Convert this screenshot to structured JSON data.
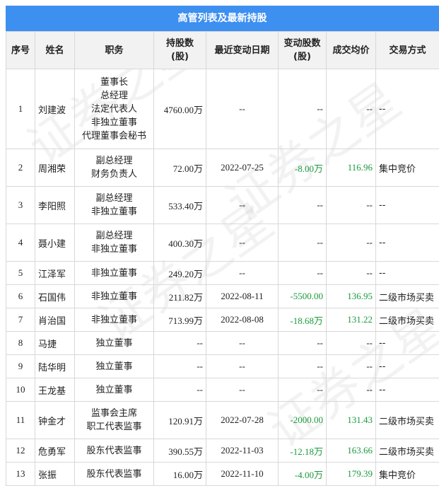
{
  "title": "高管列表及最新持股",
  "headers": [
    "序号",
    "姓名",
    "职务",
    "持股数\n(股)",
    "最近变动日期",
    "变动股数\n(股)",
    "成交均价",
    "交易方式"
  ],
  "watermark_text": "证券之星",
  "rows": [
    {
      "no": "1",
      "name": "刘建波",
      "role": "董事长\n总经理\n法定代表人\n非独立董事\n代理董事会秘书",
      "shares": "4760.00万",
      "date": "--",
      "change": "--",
      "price": "--",
      "method": "--"
    },
    {
      "no": "2",
      "name": "周湘荣",
      "role": "副总经理\n财务负责人",
      "shares": "72.00万",
      "date": "2022-07-25",
      "change": "-8.00万",
      "price": "116.96",
      "method": "集中竞价"
    },
    {
      "no": "3",
      "name": "李阳照",
      "role": "副总经理\n非独立董事",
      "shares": "533.40万",
      "date": "--",
      "change": "--",
      "price": "--",
      "method": "--"
    },
    {
      "no": "4",
      "name": "聂小建",
      "role": "副总经理\n非独立董事",
      "shares": "400.30万",
      "date": "--",
      "change": "--",
      "price": "--",
      "method": "--"
    },
    {
      "no": "5",
      "name": "江泽军",
      "role": "非独立董事",
      "shares": "249.20万",
      "date": "--",
      "change": "--",
      "price": "--",
      "method": "--"
    },
    {
      "no": "6",
      "name": "石国伟",
      "role": "非独立董事",
      "shares": "211.82万",
      "date": "2022-08-11",
      "change": "-5500.00",
      "price": "136.95",
      "method": "二级市场买卖"
    },
    {
      "no": "7",
      "name": "肖治国",
      "role": "非独立董事",
      "shares": "713.99万",
      "date": "2022-08-08",
      "change": "-18.68万",
      "price": "131.22",
      "method": "二级市场买卖"
    },
    {
      "no": "8",
      "name": "马捷",
      "role": "独立董事",
      "shares": "--",
      "date": "--",
      "change": "--",
      "price": "--",
      "method": "--"
    },
    {
      "no": "9",
      "name": "陆华明",
      "role": "独立董事",
      "shares": "--",
      "date": "--",
      "change": "--",
      "price": "--",
      "method": "--"
    },
    {
      "no": "10",
      "name": "王龙基",
      "role": "独立董事",
      "shares": "--",
      "date": "--",
      "change": "--",
      "price": "--",
      "method": "--"
    },
    {
      "no": "11",
      "name": "钟金才",
      "role": "监事会主席\n职工代表监事",
      "shares": "120.91万",
      "date": "2022-07-28",
      "change": "-2000.00",
      "price": "131.43",
      "method": "二级市场买卖"
    },
    {
      "no": "12",
      "name": "危勇军",
      "role": "股东代表监事",
      "shares": "390.55万",
      "date": "2022-11-03",
      "change": "-12.18万",
      "price": "163.66",
      "method": "二级市场买卖"
    },
    {
      "no": "13",
      "name": "张振",
      "role": "股东代表监事",
      "shares": "16.00万",
      "date": "2022-11-10",
      "change": "-4.00万",
      "price": "179.39",
      "method": "集中竞价"
    }
  ]
}
